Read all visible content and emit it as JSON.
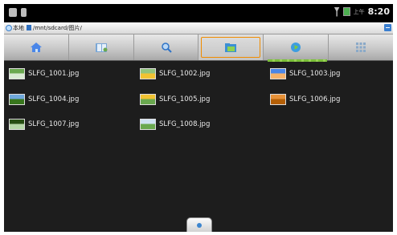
{
  "statusbar": {
    "ampm": "上午",
    "time": "8:20"
  },
  "path": {
    "local": "本地",
    "current": "/mnt/sdcard/图片/"
  },
  "toolbar": {
    "buttons": [
      {
        "name": "home",
        "icon": "home-icon"
      },
      {
        "name": "bookmarks",
        "icon": "bookmark-book-icon"
      },
      {
        "name": "search",
        "icon": "search-icon"
      },
      {
        "name": "folder",
        "icon": "folder-icon",
        "active": true
      },
      {
        "name": "network",
        "icon": "globe-icon"
      },
      {
        "name": "apps",
        "icon": "grid-icon"
      }
    ]
  },
  "files": [
    {
      "name": "SLFG_1001.jpg",
      "thumb": [
        "#6aa84f",
        "#d9ead3"
      ]
    },
    {
      "name": "SLFG_1002.jpg",
      "thumb": [
        "#93c47d",
        "#f1c232"
      ]
    },
    {
      "name": "SLFG_1003.jpg",
      "thumb": [
        "#4a86e8",
        "#f6b26b"
      ]
    },
    {
      "name": "SLFG_1004.jpg",
      "thumb": [
        "#6fa8dc",
        "#38761d"
      ]
    },
    {
      "name": "SLFG_1005.jpg",
      "thumb": [
        "#f1c232",
        "#6aa84f"
      ]
    },
    {
      "name": "SLFG_1006.jpg",
      "thumb": [
        "#e69138",
        "#b45f06"
      ]
    },
    {
      "name": "SLFG_1007.jpg",
      "thumb": [
        "#274e13",
        "#b6d7a8"
      ]
    },
    {
      "name": "SLFG_1008.jpg",
      "thumb": [
        "#cfe2f3",
        "#6aa84f"
      ]
    }
  ]
}
